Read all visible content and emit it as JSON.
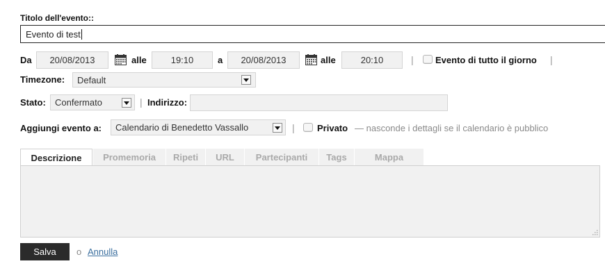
{
  "event_title": {
    "label": "Titolo dell'evento::",
    "value": "Evento di test"
  },
  "date_row": {
    "from_label": "Da",
    "from_date": "20/08/2013",
    "from_time_label": "alle",
    "from_time": "19:10",
    "to_label": "a",
    "to_date": "20/08/2013",
    "to_time_label": "alle",
    "to_time": "20:10",
    "separator": "|",
    "all_day_label": "Evento di tutto il giorno",
    "trailing_separator": "|"
  },
  "timezone": {
    "label": "Timezone:",
    "value": "Default"
  },
  "status_row": {
    "status_label": "Stato:",
    "status_value": "Confermato",
    "separator": "|",
    "address_label": "Indirizzo:",
    "address_value": ""
  },
  "calendar_row": {
    "label": "Aggiungi evento a:",
    "calendar_value": "Calendario di Benedetto Vassallo",
    "separator": "|",
    "private_label": "Privato",
    "private_hint": "— nasconde i dettagli se il calendario è pubblico"
  },
  "tabs": [
    {
      "label": "Descrizione",
      "active": true
    },
    {
      "label": "Promemoria",
      "active": false
    },
    {
      "label": "Ripeti",
      "active": false
    },
    {
      "label": "URL",
      "active": false
    },
    {
      "label": "Partecipanti",
      "active": false
    },
    {
      "label": "Tags",
      "active": false
    },
    {
      "label": "Mappa",
      "active": false
    }
  ],
  "description": {
    "value": ""
  },
  "actions": {
    "save_label": "Salva",
    "or_label": "o",
    "cancel_label": "Annulla"
  },
  "colors": {
    "field_bg": "#f1f1f1",
    "field_border": "#d4d4d4",
    "save_button_bg": "#2b2b2b",
    "link": "#3a6e9e",
    "inactive_tab": "#a9a9a9"
  },
  "icons": {
    "calendar": "calendar-icon",
    "dropdown": "chevron-down-icon",
    "resize": "resize-grip-icon"
  }
}
